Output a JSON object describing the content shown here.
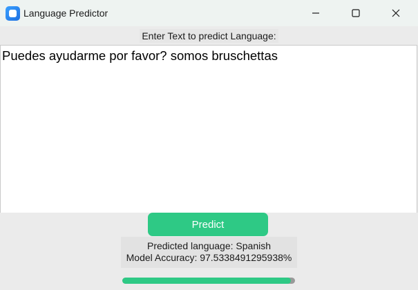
{
  "window": {
    "title": "Language Predictor",
    "icon": "app-icon"
  },
  "prompt_label": "Enter Text to predict Language:",
  "input_text": "Puedes ayudarme por favor? somos bruschettas",
  "predict_button_label": "Predict",
  "result": {
    "predicted_language": "Predicted language: Spanish",
    "model_accuracy": "Model Accuracy: 97.5338491295938%"
  },
  "progress": {
    "fraction": 0.975338491295938
  },
  "colors": {
    "accent": "#2ec985",
    "background": "#ebebeb",
    "input_bg": "#ffffff"
  }
}
